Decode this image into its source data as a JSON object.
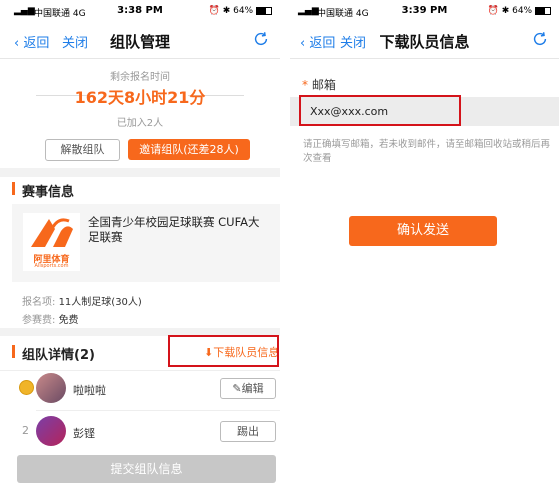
{
  "left": {
    "status": {
      "carrier": "中国联通 4G",
      "time": "3:38 PM",
      "battery": "64%"
    },
    "nav": {
      "back": "返回",
      "close": "关闭",
      "title": "组队管理"
    },
    "timer": {
      "label": "剩余报名时间",
      "value": "162天8小时21分",
      "joined": "已加入2人"
    },
    "actions": {
      "disband": "解散组队",
      "invite": "邀请组队(还差28人)"
    },
    "event_section": {
      "title": "赛事信息",
      "event_name": "全国青少年校园足球联赛 CUFA大足联赛",
      "logo_text_cn": "阿里体育",
      "logo_text_en": "Alisports.com",
      "registration_label": "报名项:",
      "registration_value": "11人制足球(30人)",
      "fee_label": "参赛费:",
      "fee_value": "免费"
    },
    "team_section": {
      "title": "组队详情(2)",
      "download": "下载队员信息",
      "members": [
        {
          "rank": "",
          "name": "啦啦啦",
          "action": "编辑"
        },
        {
          "rank": "2",
          "name": "彭铿",
          "action": "踢出"
        }
      ]
    },
    "submit": "提交组队信息"
  },
  "right": {
    "status": {
      "carrier": "中国联通 4G",
      "time": "3:39 PM",
      "battery": "64%"
    },
    "nav": {
      "back": "返回",
      "close": "关闭",
      "title": "下载队员信息"
    },
    "form": {
      "required_mark": "*",
      "email_label": "邮箱",
      "email_value": "Xxx@xxx.com",
      "hint": "请正确填写邮箱，若未收到邮件，请至邮箱回收站或稍后再次查看",
      "confirm": "确认发送"
    }
  },
  "colors": {
    "accent": "#f7681c",
    "link": "#1e7de8",
    "highlight": "#d4131a"
  }
}
